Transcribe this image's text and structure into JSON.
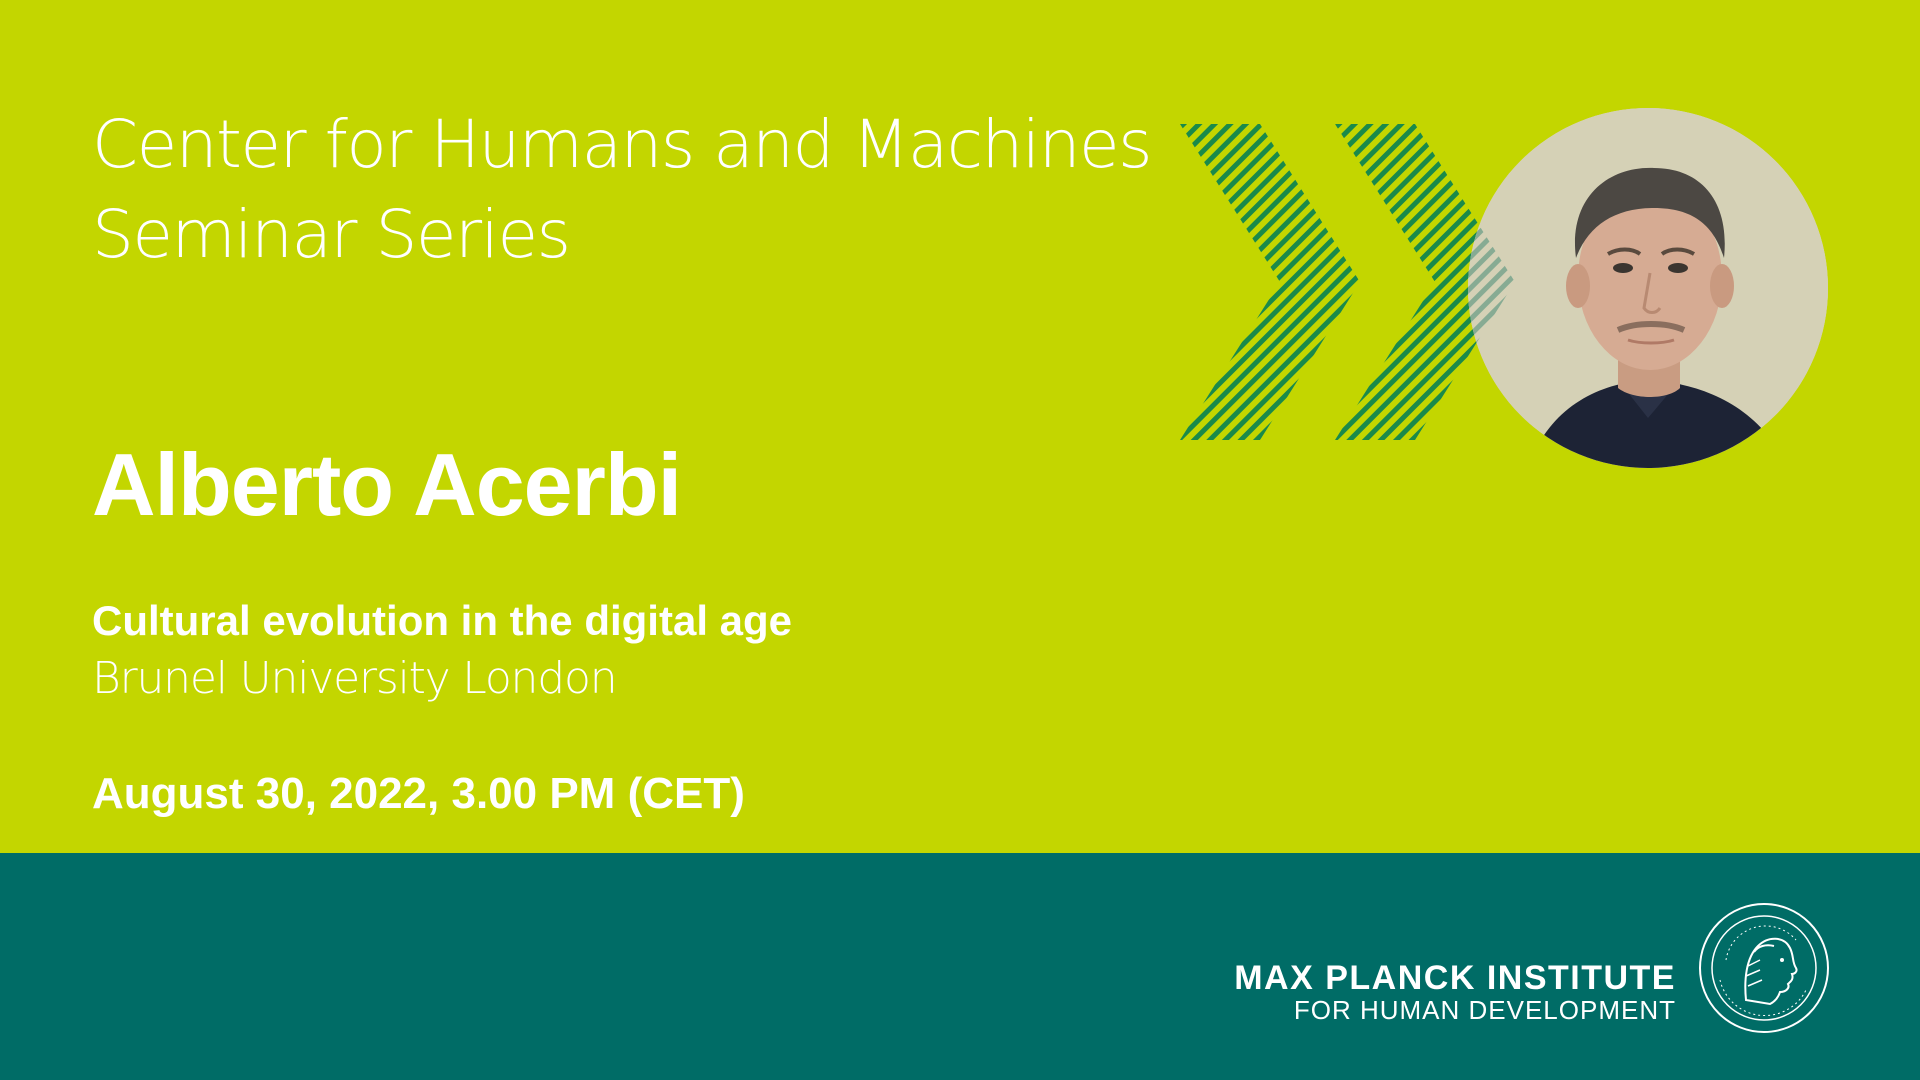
{
  "event": {
    "series_title_line1": "Center for Humans and Machines",
    "series_title_line2": "Seminar Series",
    "speaker_name": "Alberto Acerbi",
    "talk_title": "Cultural evolution in the digital age",
    "affiliation": "Brunel University London",
    "date_time": "August 30, 2022, 3.00 PM (CET)"
  },
  "branding": {
    "institute_name": "MAX PLANCK INSTITUTE",
    "institute_subtitle": "FOR HUMAN DEVELOPMENT",
    "logo_icon": "minerva-seal-icon",
    "decoration_icon": "double-chevron-icon"
  },
  "colors": {
    "background_top": "#c3d600",
    "background_bottom": "#006c66",
    "chevron_stripe": "#1a8a4a",
    "text": "#ffffff"
  }
}
